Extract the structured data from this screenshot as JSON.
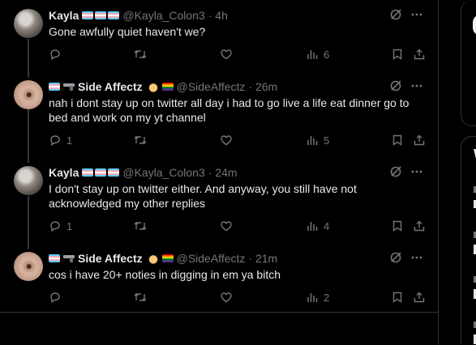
{
  "tweets": [
    {
      "name": "Kayla",
      "name_decor": "transgender-flag x3",
      "handle": "@Kayla_Colon3",
      "time": "· 4h",
      "text": "Gone awfully quiet haven't we?",
      "replies": "",
      "views": "6",
      "avatar": "cat"
    },
    {
      "name_prefix_decor": "transgender-flag, gun",
      "name": "Side Affectz",
      "name_decor": "hand, rainbow-flag",
      "handle": "@SideAffectz",
      "time": "· 26m",
      "text": "nah i dont stay up on twitter all day i had to go live a life eat dinner go to bed and work on my yt channel",
      "replies": "1",
      "views": "5",
      "avatar": "face"
    },
    {
      "name": "Kayla",
      "name_decor": "transgender-flag x3",
      "handle": "@Kayla_Colon3",
      "time": "· 24m",
      "text": "I don't stay up on twitter either. And anyway, you still have not acknowledged my other replies",
      "replies": "1",
      "views": "4",
      "avatar": "cat"
    },
    {
      "name_prefix_decor": "transgender-flag, gun",
      "name": "Side Affectz",
      "name_decor": "hand, rainbow-flag",
      "handle": "@SideAffectz",
      "time": "· 21m",
      "text": "cos i have 20+ noties in digging in em ya bitch",
      "replies": "",
      "views": "2",
      "avatar": "face"
    }
  ],
  "icons": {
    "grok": "grok-icon",
    "more": "more-icon",
    "reply": "reply-icon",
    "retweet": "retweet-icon",
    "like": "like-icon",
    "views": "views-icon",
    "bookmark": "bookmark-icon",
    "share": "share-icon"
  },
  "right_sidebar": {
    "section_letter": "W"
  },
  "colors": {
    "background": "#000000",
    "text": "#e7e9ea",
    "muted": "#71767b",
    "border": "#2f3336"
  }
}
